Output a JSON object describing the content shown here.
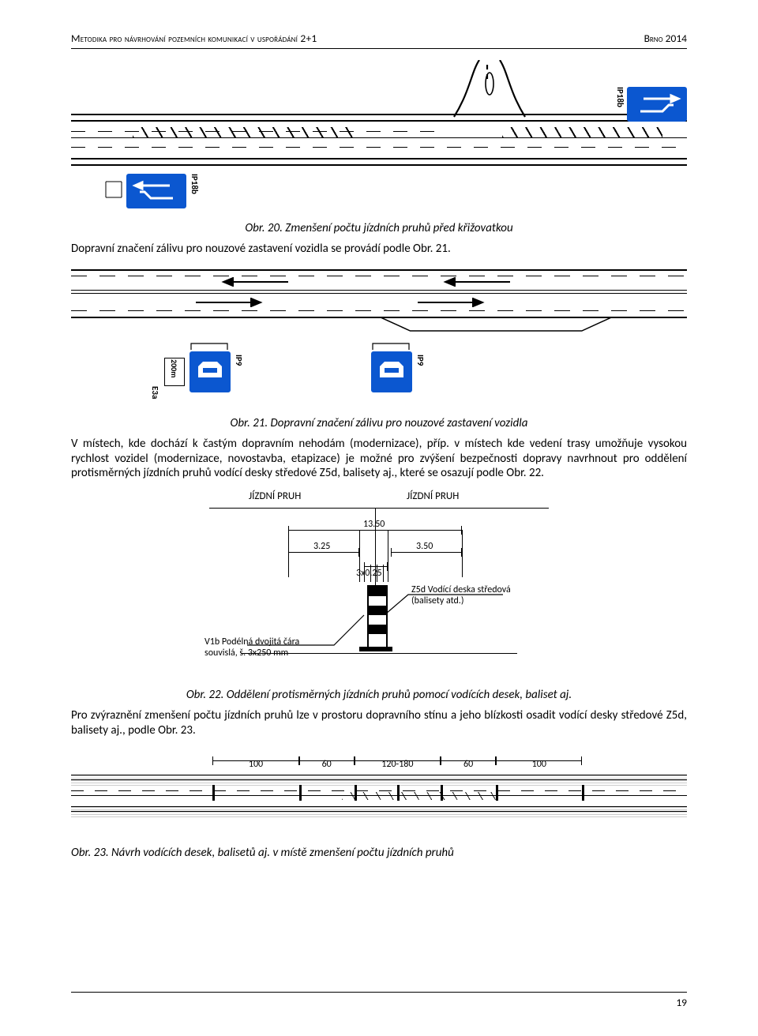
{
  "header": {
    "left": "Metodika pro návrhování pozemních komunikací v uspořádání 2+1",
    "right": "Brno 2014"
  },
  "fig20": {
    "caption": "Obr. 20. Zmenšení počtu jízdních pruhů před křižovatkou",
    "sign_label_right": "IP18b",
    "sign_label_left": "IP18b"
  },
  "para1": "Dopravní značení zálivu pro nouzové zastavení vozidla se provádí podle Obr. 21.",
  "fig21": {
    "caption": "Obr. 21. Dopravní značení zálivu pro nouzové zastavení vozidla",
    "label_e3a": "E3a",
    "label_200m": "200m",
    "label_ip9_left": "IP9",
    "label_ip9_right": "IP9"
  },
  "para2": "V místech, kde dochází k častým dopravním nehodám (modernizace), příp. v místech kde vedení trasy umožňuje vysokou rychlost vozidel (modernizace, novostavba, etapizace) je možné pro zvýšení bezpečnosti dopravy navrhnout pro oddělení protisměrných jízdních pruhů vodící desky středové Z5d, balisety aj., které se osazují podle Obr. 22.",
  "fig22": {
    "caption": "Obr. 22. Oddělení protisměrných jízdních pruhů pomocí vodících desek, baliset aj.",
    "header_left": "JÍZDNÍ PRUH",
    "header_right": "JÍZDNÍ PRUH",
    "dim_total": "13.50",
    "dim_left": "3.25",
    "dim_mid": "3x0.25",
    "dim_right": "3.50",
    "note_left_l1": "V1b Podélná dvojitá čára",
    "note_left_l2": "souvislá, š. 3x250 mm",
    "note_right_l1": "Z5d Vodící deska středová",
    "note_right_l2": "(balisety atd.)"
  },
  "para3": "Pro zvýraznění zmenšení počtu jízdních pruhů lze v prostoru dopravního stínu a jeho blízkosti osadit vodící desky středové Z5d, balisety aj., podle Obr. 23.",
  "fig23": {
    "caption": "Obr. 23. Návrh vodících desek, balisetů aj. v místě zmenšení počtu jízdních pruhů",
    "d1": "100",
    "d2": "60",
    "d3": "120-180",
    "d4": "60",
    "d5": "100"
  },
  "footer": {
    "page": "19"
  }
}
